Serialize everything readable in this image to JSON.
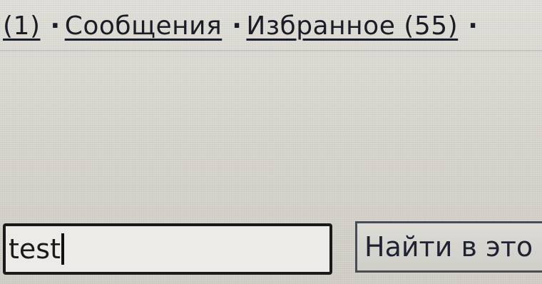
{
  "nav": {
    "link_partial": "(1)",
    "separator": "·",
    "messages": "Сообщения",
    "favorites": "Избранное (55)"
  },
  "search": {
    "value": "test",
    "button_label": "Найти в это"
  }
}
